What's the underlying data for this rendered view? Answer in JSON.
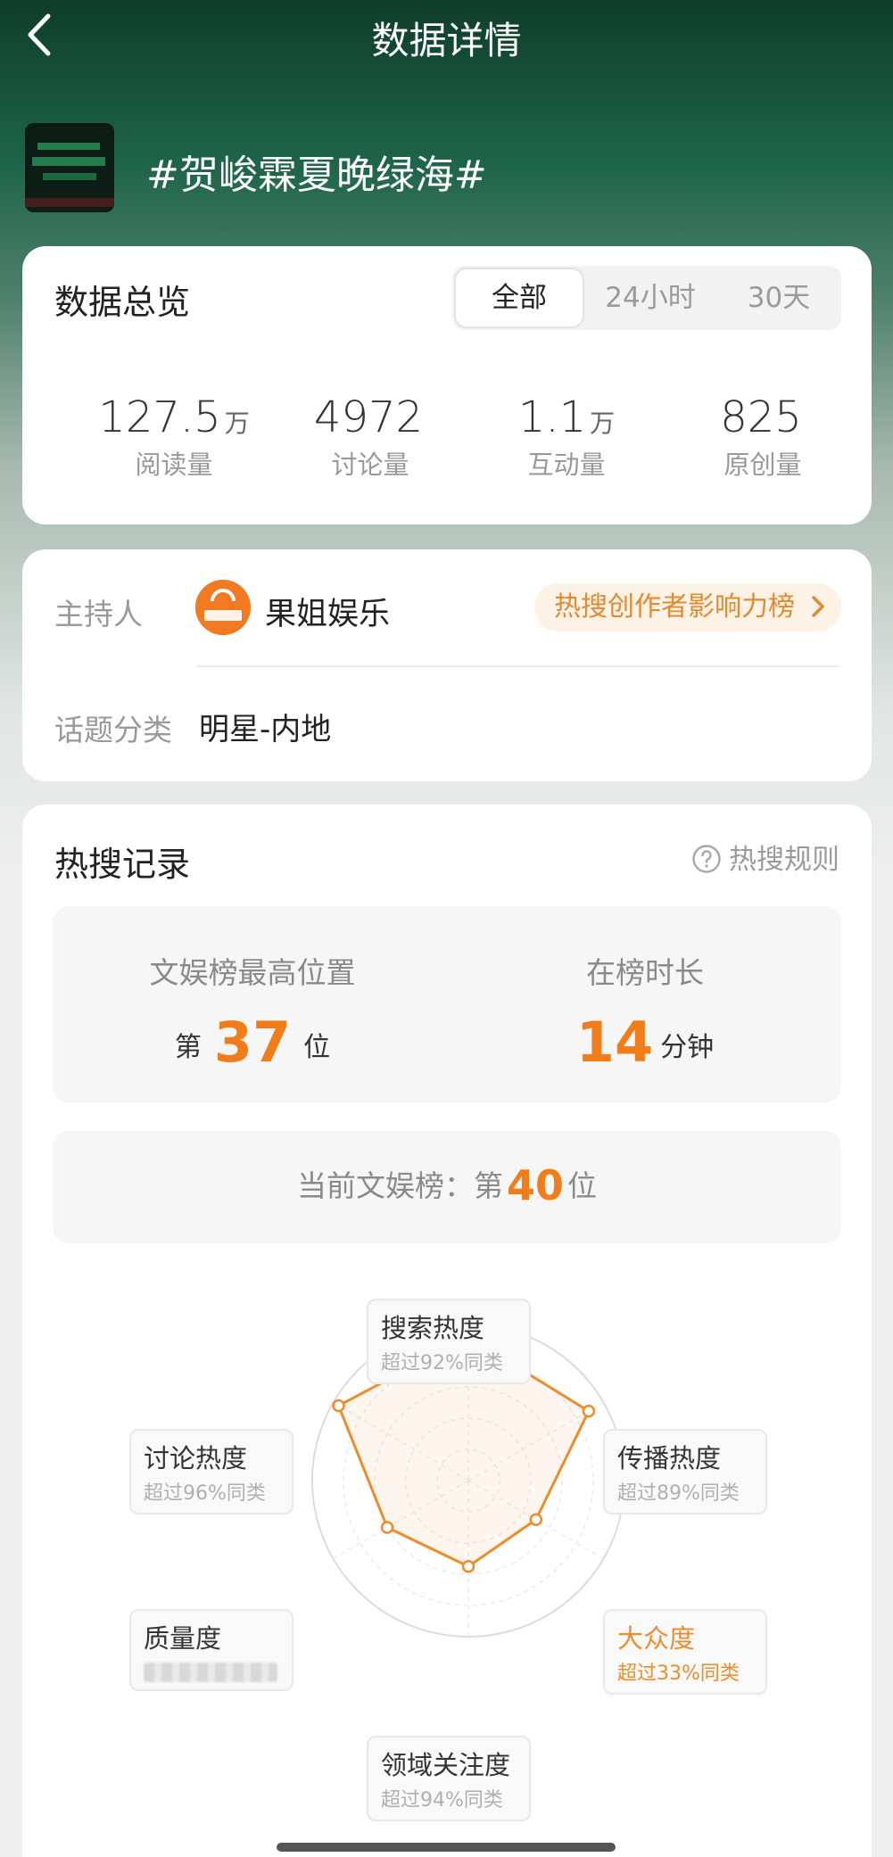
{
  "header": {
    "title": "数据详情"
  },
  "topic": {
    "title": "#贺峻霖夏晚绿海#"
  },
  "overview": {
    "title": "数据总览",
    "tabs": [
      "全部",
      "24小时",
      "30天"
    ],
    "active_tab": "全部",
    "stats": [
      {
        "value": "127.5",
        "unit": "万",
        "label": "阅读量"
      },
      {
        "value": "4972",
        "unit": "",
        "label": "讨论量"
      },
      {
        "value": "1.1",
        "unit": "万",
        "label": "互动量"
      },
      {
        "value": "825",
        "unit": "",
        "label": "原创量"
      }
    ]
  },
  "host": {
    "label": "主持人",
    "name": "果姐娱乐",
    "logo_text": "果姐娱乐",
    "rank_link": "热搜创作者影响力榜"
  },
  "category": {
    "label": "话题分类",
    "value": "明星-内地"
  },
  "hot_record": {
    "title": "热搜记录",
    "rules_link": "热搜规则",
    "best_title": "文娱榜最高位置",
    "best_prefix": "第",
    "best_value": "37",
    "best_suffix": "位",
    "duration_title": "在榜时长",
    "duration_value": "14",
    "duration_unit": "分钟",
    "current_text": "当前文娱榜：第",
    "current_value": "40",
    "current_suffix": "位"
  },
  "radar": {
    "accent_color": "#ef8c2a",
    "dimensions": [
      {
        "title": "搜索热度",
        "sub": "超过92%同类",
        "level": 0.92,
        "highlight": false
      },
      {
        "title": "传播热度",
        "sub": "超过89%同类",
        "level": 0.89,
        "highlight": false
      },
      {
        "title": "大众度",
        "sub": "超过33%同类",
        "level": 0.5,
        "highlight": true
      },
      {
        "title": "领域关注度",
        "sub": "超过94%同类",
        "level": 0.55,
        "highlight": false
      },
      {
        "title": "质量度",
        "sub": "",
        "level": 0.6,
        "highlight": false
      },
      {
        "title": "讨论热度",
        "sub": "超过96%同类",
        "level": 0.96,
        "highlight": false
      }
    ]
  }
}
